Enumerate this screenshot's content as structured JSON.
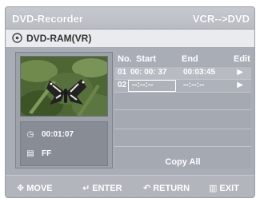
{
  "header": {
    "title": "DVD-Recorder",
    "mode": "VCR-->DVD"
  },
  "disc": {
    "label": "DVD-RAM(VR)",
    "icon": "disc-icon"
  },
  "info": {
    "time": "00:01:07",
    "speed": "FF",
    "time_icon": "clock-icon",
    "speed_icon": "tape-speed-icon"
  },
  "list": {
    "columns": {
      "no": "No.",
      "start": "Start",
      "end": "End",
      "edit": "Edit"
    },
    "rows": [
      {
        "no": "01",
        "start": "00: 00: 37",
        "end": "00:03:45",
        "edit_icon": "play-icon"
      },
      {
        "no": "02",
        "start": "--:--:--",
        "end": "--:--:--",
        "edit_icon": "play-icon"
      }
    ],
    "copy_all": "Copy All"
  },
  "footer": {
    "move": "MOVE",
    "enter": "ENTER",
    "return": "RETURN",
    "exit": "EXIT"
  },
  "colors": {
    "background": "#a9adb5",
    "highlight_row": "#b8bbc2",
    "text": "#ffffff"
  }
}
